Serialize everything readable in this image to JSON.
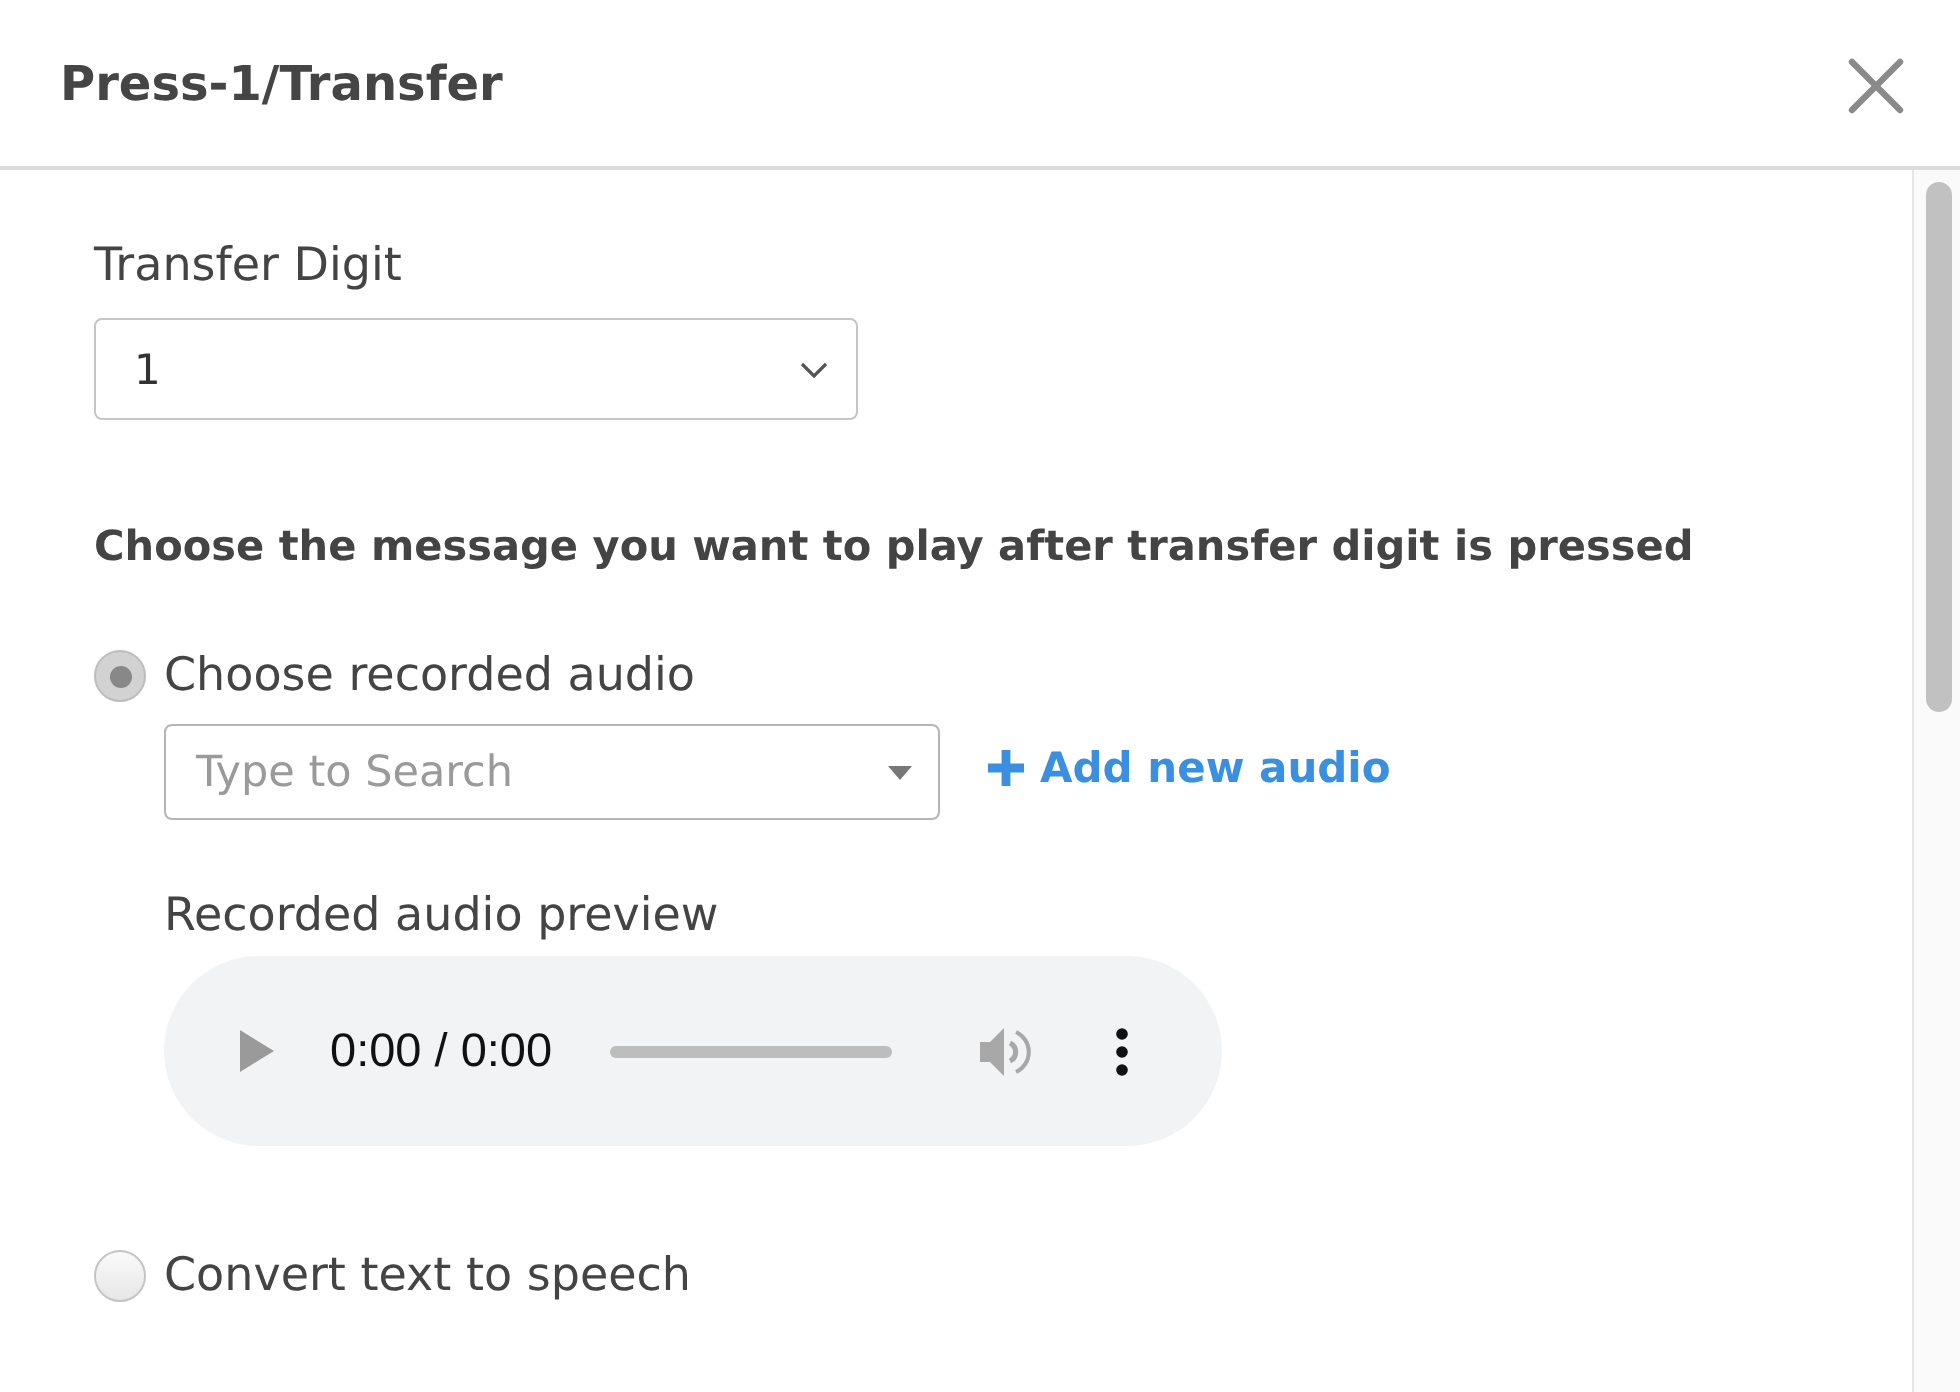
{
  "dialog": {
    "title": "Press-1/Transfer"
  },
  "transfer_digit": {
    "label": "Transfer Digit",
    "value": "1"
  },
  "message": {
    "heading": "Choose the message you want to play after transfer digit is pressed",
    "options": [
      {
        "kind": "recorded",
        "label": "Choose recorded audio",
        "selected": true,
        "search": {
          "placeholder": "Type to Search"
        },
        "add_link": "Add new audio",
        "preview": {
          "label": "Recorded audio preview",
          "time": "0:00 / 0:00"
        }
      },
      {
        "kind": "tts",
        "label": "Convert text to speech",
        "selected": false
      }
    ]
  }
}
